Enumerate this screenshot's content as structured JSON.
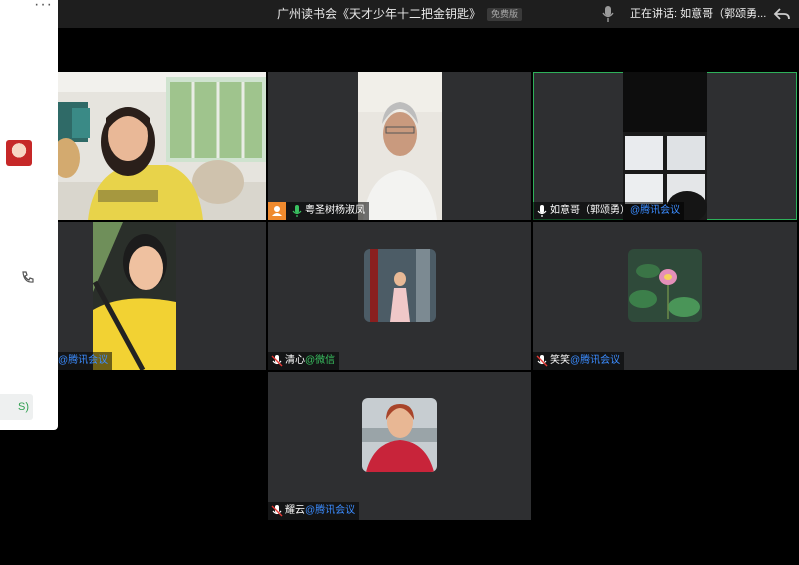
{
  "window": {
    "title": "广州读书会《天才少年十二把金钥匙》",
    "badge": "免费版",
    "speaking": "正在讲话: 如意哥（郭颂勇...",
    "more": "···"
  },
  "side_panel": {
    "button_label": "S)"
  },
  "participants": [
    {
      "name": "",
      "source": ""
    },
    {
      "name": "粤圣树杨淑凤",
      "source": ""
    },
    {
      "name": "如意哥（郭颂勇）",
      "source": "@腾讯会议"
    },
    {
      "name": "",
      "source": "@腾讯会议"
    },
    {
      "name": "清心",
      "source": "@微信"
    },
    {
      "name": "笑笑",
      "source": "@腾讯会议"
    },
    {
      "name": "耀云",
      "source": "@腾讯会议"
    }
  ],
  "colors": {
    "active_border": "#2eb05a",
    "tencent_blue": "#3b8cff",
    "wechat_green": "#39c160"
  }
}
